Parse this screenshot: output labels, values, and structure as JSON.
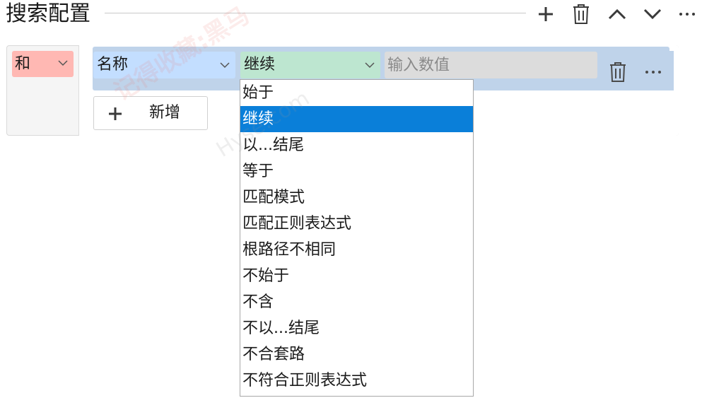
{
  "header": {
    "title": "搜索配置",
    "actions": {
      "add_icon": "plus-icon",
      "delete_icon": "trash-icon",
      "up_icon": "chevron-up-icon",
      "down_icon": "chevron-down-icon",
      "more_icon": "ellipsis-icon"
    }
  },
  "group": {
    "logic_value": "和",
    "condition": {
      "field_value": "名称",
      "operator_value": "继续",
      "value_placeholder": "输入数值"
    },
    "add_button_label": "新增"
  },
  "dropdown": {
    "selected_index": 1,
    "options": [
      "始于",
      "继续",
      "以...结尾",
      "等于",
      "匹配模式",
      "匹配正则表达式",
      "根路径不相同",
      "不始于",
      "不含",
      "不以...结尾",
      "不合套路",
      "不符合正则表达式"
    ]
  },
  "colors": {
    "logic_bg": "#ffb8b3",
    "field_bg": "#c3deff",
    "operator_bg": "#bde6d0",
    "value_bg": "#dcdcdc",
    "row_bg": "#bfd3ea",
    "selected_bg": "#0a7fd9"
  },
  "watermark": {
    "line1": "记得收藏:黑马",
    "line2": "Hyse.com"
  }
}
